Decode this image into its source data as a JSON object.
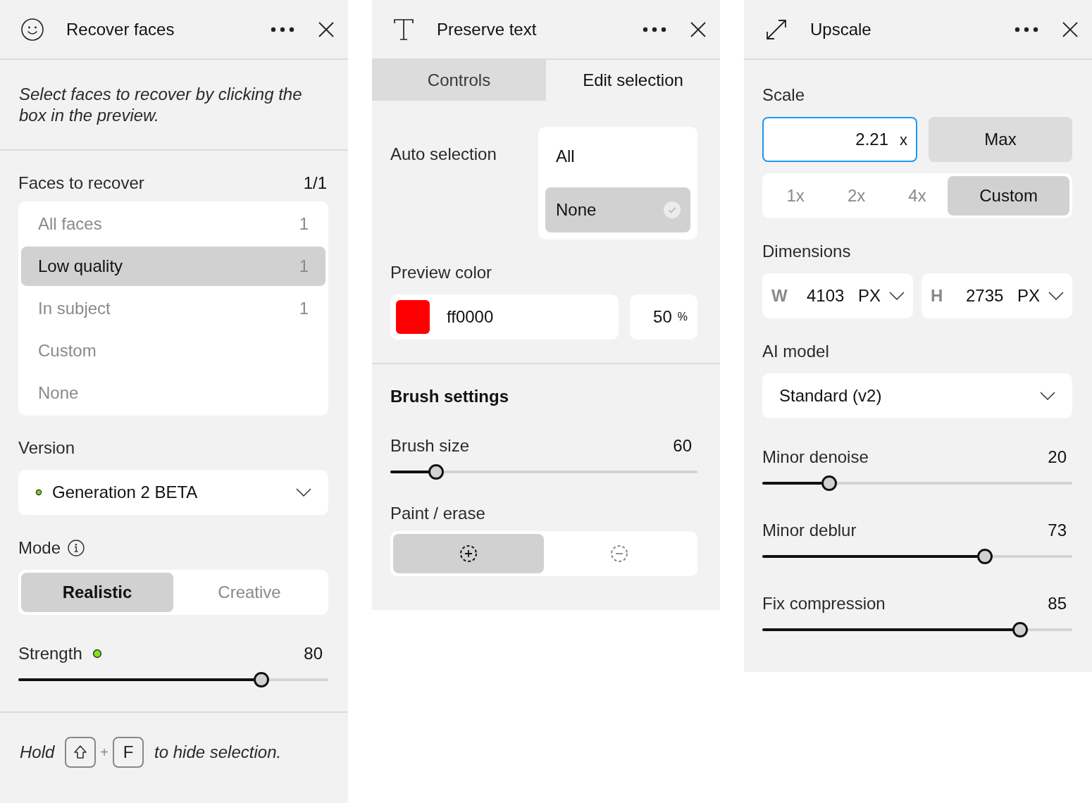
{
  "panels": [
    {
      "kind": "recover_faces",
      "title": "Recover faces",
      "description": "Select faces to recover by clicking the box in the preview.",
      "faces": {
        "label": "Faces to recover",
        "count": "1/1",
        "options": [
          {
            "label": "All faces",
            "count": "1",
            "selected": false
          },
          {
            "label": "Low quality",
            "count": "1",
            "selected": true
          },
          {
            "label": "In subject",
            "count": "1",
            "selected": false
          },
          {
            "label": "Custom",
            "selected": false
          },
          {
            "label": "None",
            "selected": false
          }
        ]
      },
      "version": {
        "label": "Version",
        "value": "Generation 2 BETA"
      },
      "mode": {
        "label": "Mode",
        "options": [
          {
            "label": "Realistic",
            "selected": true
          },
          {
            "label": "Creative",
            "selected": false
          }
        ]
      },
      "strength": {
        "label": "Strength",
        "value": "80",
        "level": 0.8
      },
      "hint": {
        "lead": "Hold",
        "keys": [
          {
            "kind": "shift"
          },
          {
            "kind": "letter",
            "label": "F"
          }
        ],
        "joiner": "+",
        "trail": "to hide selection."
      }
    },
    {
      "kind": "preserve_text",
      "title": "Preserve text",
      "tabs": [
        {
          "label": "Controls",
          "selected": false
        },
        {
          "label": "Edit selection",
          "selected": true
        }
      ],
      "auto_selection": {
        "label": "Auto selection",
        "options": [
          {
            "label": "All",
            "selected": false
          },
          {
            "label": "None",
            "selected": true
          }
        ]
      },
      "preview_color": {
        "label": "Preview color",
        "color": "#ff0000",
        "hex": "ff0000",
        "opacity": "50",
        "unit": "%"
      },
      "brush_heading": "Brush settings",
      "brush_size": {
        "label": "Brush size",
        "value": "60",
        "level": 0.13
      },
      "paint_erase": {
        "label": "Paint / erase",
        "options": [
          {
            "kind": "paint",
            "selected": true
          },
          {
            "kind": "erase",
            "selected": false
          }
        ]
      }
    },
    {
      "kind": "upscale",
      "title": "Upscale",
      "scale": {
        "label": "Scale",
        "value": "2.21",
        "suffix": "x",
        "focused": true
      },
      "max_button": "Max",
      "presets": [
        {
          "label": "1x",
          "selected": false
        },
        {
          "label": "2x",
          "selected": false
        },
        {
          "label": "4x",
          "selected": false
        },
        {
          "label": "Custom",
          "selected": true
        }
      ],
      "dimensions": {
        "label": "Dimensions",
        "fields": [
          {
            "axis": "W",
            "value": "4103",
            "unit": "PX"
          },
          {
            "axis": "H",
            "value": "2735",
            "unit": "PX"
          }
        ]
      },
      "ai_model": {
        "label": "AI model",
        "value": "Standard (v2)"
      },
      "sliders": [
        {
          "label": "Minor denoise",
          "value": "20",
          "level": 0.2
        },
        {
          "label": "Minor deblur",
          "value": "73",
          "level": 0.73
        },
        {
          "label": "Fix compression",
          "value": "85",
          "level": 0.85
        }
      ]
    }
  ]
}
